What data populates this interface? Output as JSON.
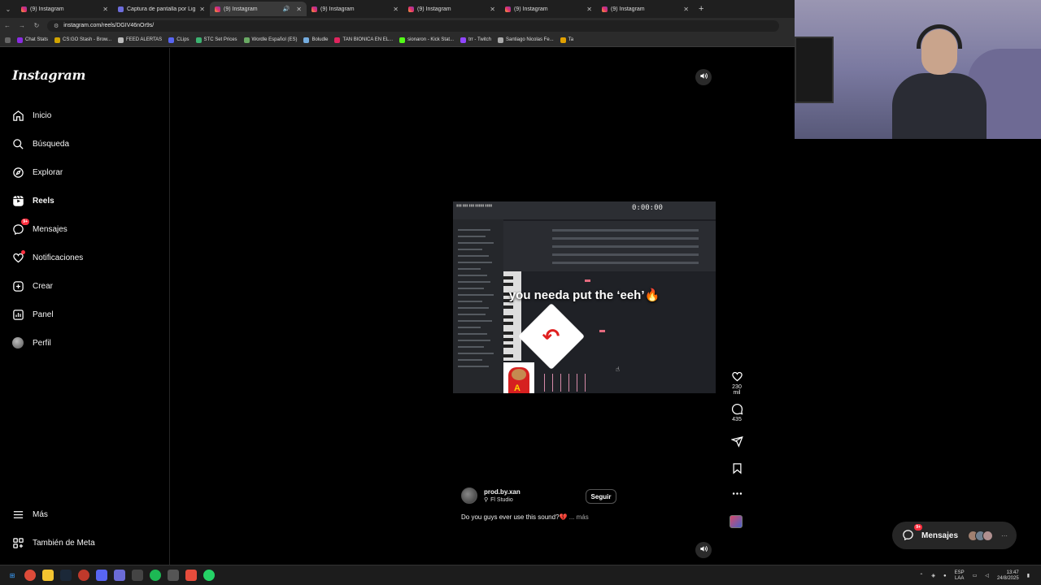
{
  "browser": {
    "tabs": [
      {
        "title": "(9) Instagram",
        "active": false
      },
      {
        "title": "Captura de pantalla por Lightsh",
        "active": false
      },
      {
        "title": "(9) Instagram",
        "active": true
      },
      {
        "title": "(9) Instagram",
        "active": false
      },
      {
        "title": "(9) Instagram",
        "active": false
      },
      {
        "title": "(9) Instagram",
        "active": false
      },
      {
        "title": "(9) Instagram",
        "active": false
      }
    ],
    "url": "instagram.com/reels/DGIV46nOr9s/",
    "bookmarks": [
      "Chat Stats",
      "CS:GO Stash - Brow...",
      "FEED ALERTAS",
      "CLips",
      "STC Set Prices",
      "Wordle Español (ES)",
      "Boludle",
      "TAN BIONICA EN EL...",
      "sionaron - Kick Stat...",
      "trr - Twitch",
      "Santiago Nicolas Fe...",
      "Ta"
    ]
  },
  "sidebar": {
    "logo": "Instagram",
    "items": [
      {
        "label": "Inicio",
        "icon": "home-icon"
      },
      {
        "label": "Búsqueda",
        "icon": "search-icon"
      },
      {
        "label": "Explorar",
        "icon": "compass-icon"
      },
      {
        "label": "Reels",
        "icon": "reels-icon"
      },
      {
        "label": "Mensajes",
        "icon": "messenger-icon",
        "badge": "9+"
      },
      {
        "label": "Notificaciones",
        "icon": "heart-icon"
      },
      {
        "label": "Crear",
        "icon": "plus-square-icon"
      },
      {
        "label": "Panel",
        "icon": "bar-chart-icon"
      },
      {
        "label": "Perfil",
        "icon": "avatar-icon"
      }
    ],
    "more": "Más",
    "meta": "También de Meta"
  },
  "reel": {
    "overlay_text": "you needa put the ‘eeh’🔥",
    "daw_time": "0:00:00",
    "likes": "230 mil",
    "comments": "435",
    "author": "prod.by.xan",
    "location": "Fl Studio",
    "follow": "Seguir",
    "caption": "Do you guys ever use this sound?💔",
    "caption_more": "... más"
  },
  "messages_bubble": {
    "label": "Mensajes",
    "badge": "9+"
  },
  "taskbar": {
    "lang_top": "ESP",
    "lang_bottom": "LAA",
    "time": "13:47",
    "date": "24/8/2025"
  }
}
